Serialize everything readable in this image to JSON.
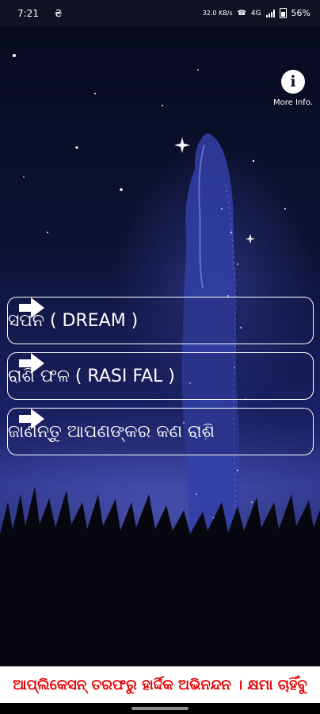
{
  "status_bar": {
    "time": "7:21",
    "notification_glyph": "₴",
    "network_speed": "32.0 KB/s",
    "network_label": "4G",
    "battery": "56%",
    "icons": [
      "wifi-calling-icon",
      "signal-icon",
      "battery-icon"
    ]
  },
  "info": {
    "icon": "i",
    "label": "More Info."
  },
  "menu": {
    "items": [
      {
        "label": "ସପନ ( DREAM )",
        "icon": "arrow-right-icon"
      },
      {
        "label": "ରାଶି ଫଳ ( RASI FAL )",
        "icon": "arrow-right-icon"
      },
      {
        "label": "ଜାଣନ୍ତୁ ଆପଣଙ୍କର କଣ ରାଶି",
        "icon": "arrow-right-icon"
      }
    ]
  },
  "banner": {
    "text": "ଆପ୍ଲିକେସନ୍ ତରଫରୁ ହାର୍ଦ୍ଦିକ ଅଭିନନ୍ଦନ । କ୍ଷମା ଚାହିଁବୁ"
  },
  "colors": {
    "background": "#0b0f2a",
    "button_border": "#ffffff",
    "banner_text": "#e50000",
    "banner_bg": "#ffffff"
  }
}
